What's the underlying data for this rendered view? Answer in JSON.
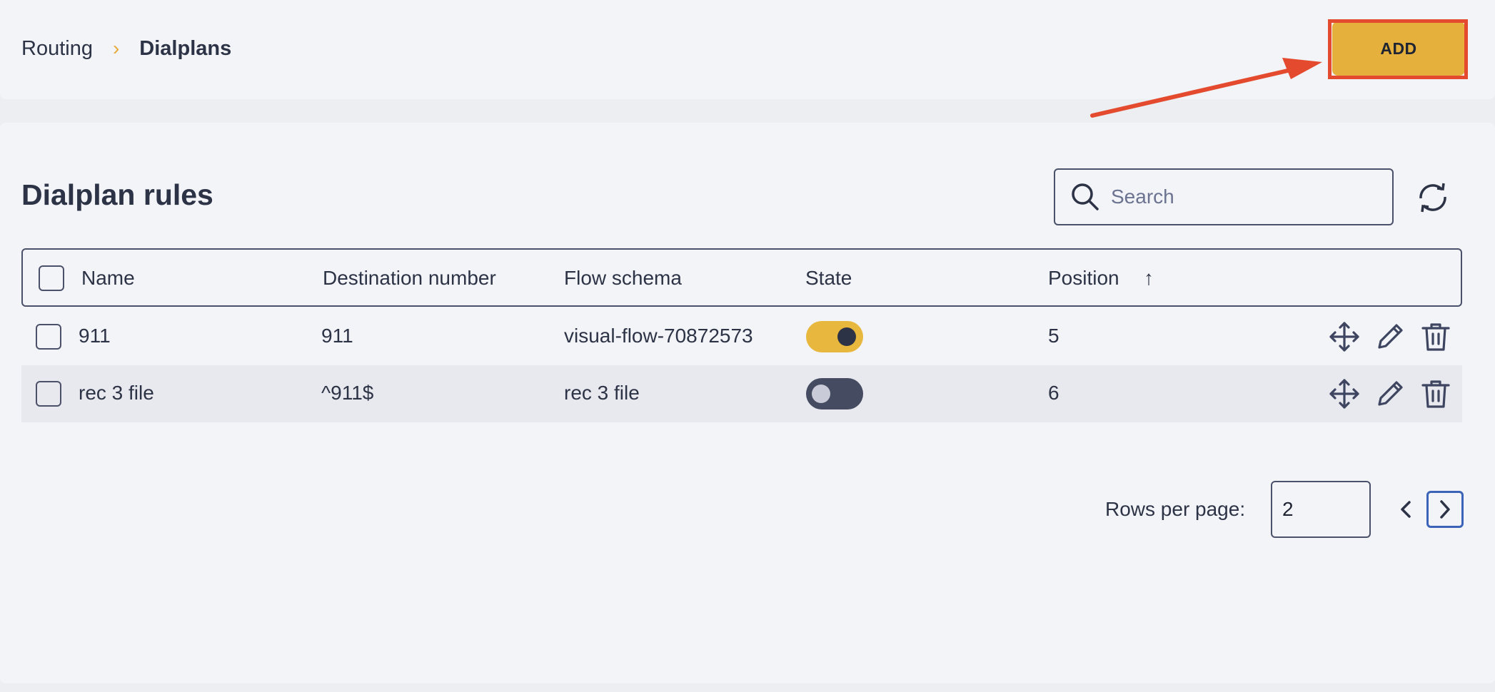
{
  "breadcrumb": {
    "parent": "Routing",
    "separator": "›",
    "current": "Dialplans"
  },
  "toolbar": {
    "add_label": "ADD"
  },
  "panel": {
    "title": "Dialplan rules"
  },
  "search": {
    "placeholder": "Search"
  },
  "table": {
    "columns": [
      "Name",
      "Destination number",
      "Flow schema",
      "State",
      "Position"
    ],
    "sort_indicator": "↑",
    "rows": [
      {
        "name": "911",
        "destination": "911",
        "flow": "visual-flow-70872573",
        "state": "on",
        "position": "5"
      },
      {
        "name": "rec 3 file",
        "destination": "^911$",
        "flow": "rec 3 file",
        "state": "off",
        "position": "6"
      }
    ]
  },
  "pagination": {
    "rows_label": "Rows per page:",
    "rows_value": "2"
  },
  "colors": {
    "accent": "#e6b03d",
    "highlight": "#e34a2e",
    "text": "#2d3346",
    "link_border": "#3b63b7"
  },
  "icons": [
    "search-icon",
    "refresh-icon",
    "move-icon",
    "edit-icon",
    "trash-icon",
    "chevron-left-icon",
    "chevron-right-icon"
  ]
}
